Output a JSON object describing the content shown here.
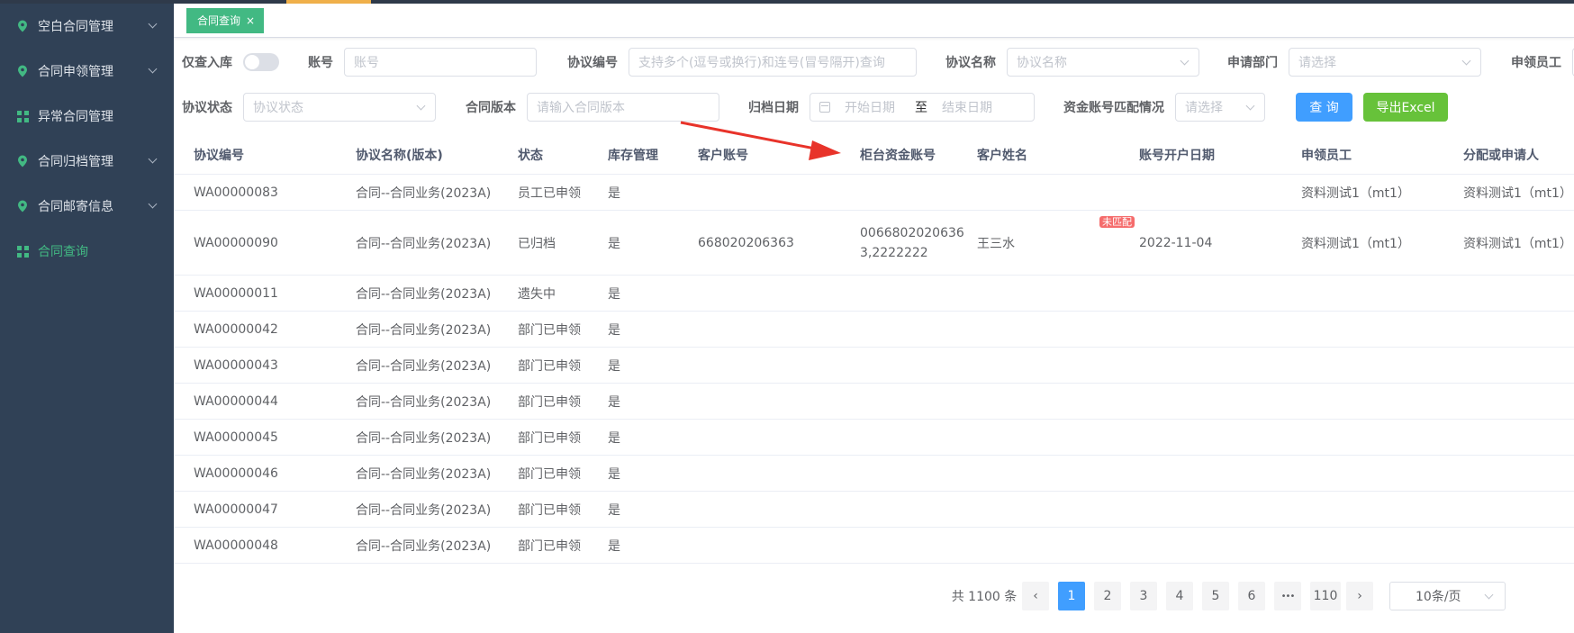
{
  "sidebar": {
    "items": [
      {
        "label": "空白合同管理",
        "icon": "location-pin-icon"
      },
      {
        "label": "合同申领管理",
        "icon": "location-pin-icon"
      },
      {
        "label": "异常合同管理",
        "icon": "grid-icon"
      },
      {
        "label": "合同归档管理",
        "icon": "location-pin-icon"
      },
      {
        "label": "合同邮寄信息",
        "icon": "location-pin-icon"
      },
      {
        "label": "合同查询",
        "icon": "grid-icon"
      }
    ]
  },
  "tabs": [
    {
      "label": "合同查询",
      "close": "×"
    }
  ],
  "filters": {
    "only_stored_label": "仅查入库",
    "account_label": "账号",
    "account_placeholder": "账号",
    "protocol_no_label": "协议编号",
    "protocol_no_placeholder": "支持多个(逗号或换行)和连号(冒号隔开)查询",
    "protocol_name_label": "协议名称",
    "protocol_name_placeholder": "协议名称",
    "dept_label": "申请部门",
    "dept_placeholder": "请选择",
    "staff_label": "申领员工",
    "status_label": "协议状态",
    "status_placeholder": "协议状态",
    "version_label": "合同版本",
    "version_placeholder": "请输入合同版本",
    "archive_date_label": "归档日期",
    "start_date_placeholder": "开始日期",
    "date_sep": "至",
    "end_date_placeholder": "结束日期",
    "match_label": "资金账号匹配情况",
    "match_placeholder": "请选择",
    "query_button": "查 询",
    "export_button": "导出Excel"
  },
  "table": {
    "headers": [
      "协议编号",
      "协议名称(版本)",
      "状态",
      "库存管理",
      "客户账号",
      "柜台资金账号",
      "客户姓名",
      "账号开户日期",
      "申领员工",
      "分配或申请人"
    ],
    "rows": [
      [
        "WA00000083",
        "合同--合同业务(2023A)",
        "员工已申领",
        "是",
        "",
        "",
        "",
        "",
        "资料测试1（mt1）",
        "资料测试1（mt1）"
      ],
      [
        "WA00000090",
        "合同--合同业务(2023A)",
        "已归档",
        "是",
        "668020206363",
        "00668020206363,2222222",
        "王三水",
        "2022-11-04",
        "资料测试1（mt1）",
        "资料测试1（mt1）"
      ],
      [
        "WA00000011",
        "合同--合同业务(2023A)",
        "遗失中",
        "是",
        "",
        "",
        "",
        "",
        "",
        ""
      ],
      [
        "WA00000042",
        "合同--合同业务(2023A)",
        "部门已申领",
        "是",
        "",
        "",
        "",
        "",
        "",
        ""
      ],
      [
        "WA00000043",
        "合同--合同业务(2023A)",
        "部门已申领",
        "是",
        "",
        "",
        "",
        "",
        "",
        ""
      ],
      [
        "WA00000044",
        "合同--合同业务(2023A)",
        "部门已申领",
        "是",
        "",
        "",
        "",
        "",
        "",
        ""
      ],
      [
        "WA00000045",
        "合同--合同业务(2023A)",
        "部门已申领",
        "是",
        "",
        "",
        "",
        "",
        "",
        ""
      ],
      [
        "WA00000046",
        "合同--合同业务(2023A)",
        "部门已申领",
        "是",
        "",
        "",
        "",
        "",
        "",
        ""
      ],
      [
        "WA00000047",
        "合同--合同业务(2023A)",
        "部门已申领",
        "是",
        "",
        "",
        "",
        "",
        "",
        ""
      ],
      [
        "WA00000048",
        "合同--合同业务(2023A)",
        "部门已申领",
        "是",
        "",
        "",
        "",
        "",
        "",
        ""
      ]
    ],
    "row2_account_line1": "0066802020636",
    "row2_account_line2": "3,2222222",
    "unmatched_badge": "未匹配"
  },
  "pagination": {
    "total": "共 1100 条",
    "prev": "‹",
    "pages": [
      "1",
      "2",
      "3",
      "4",
      "5",
      "6"
    ],
    "ellipsis": "•••",
    "last": "110",
    "next": "›",
    "page_size": "10条/页",
    "current": "1"
  },
  "colors": {
    "sidebar_bg": "#304156",
    "accent_green": "#42b983",
    "primary_blue": "#409eff",
    "excel_green": "#67c23a",
    "arrow_red": "#e8332a"
  }
}
